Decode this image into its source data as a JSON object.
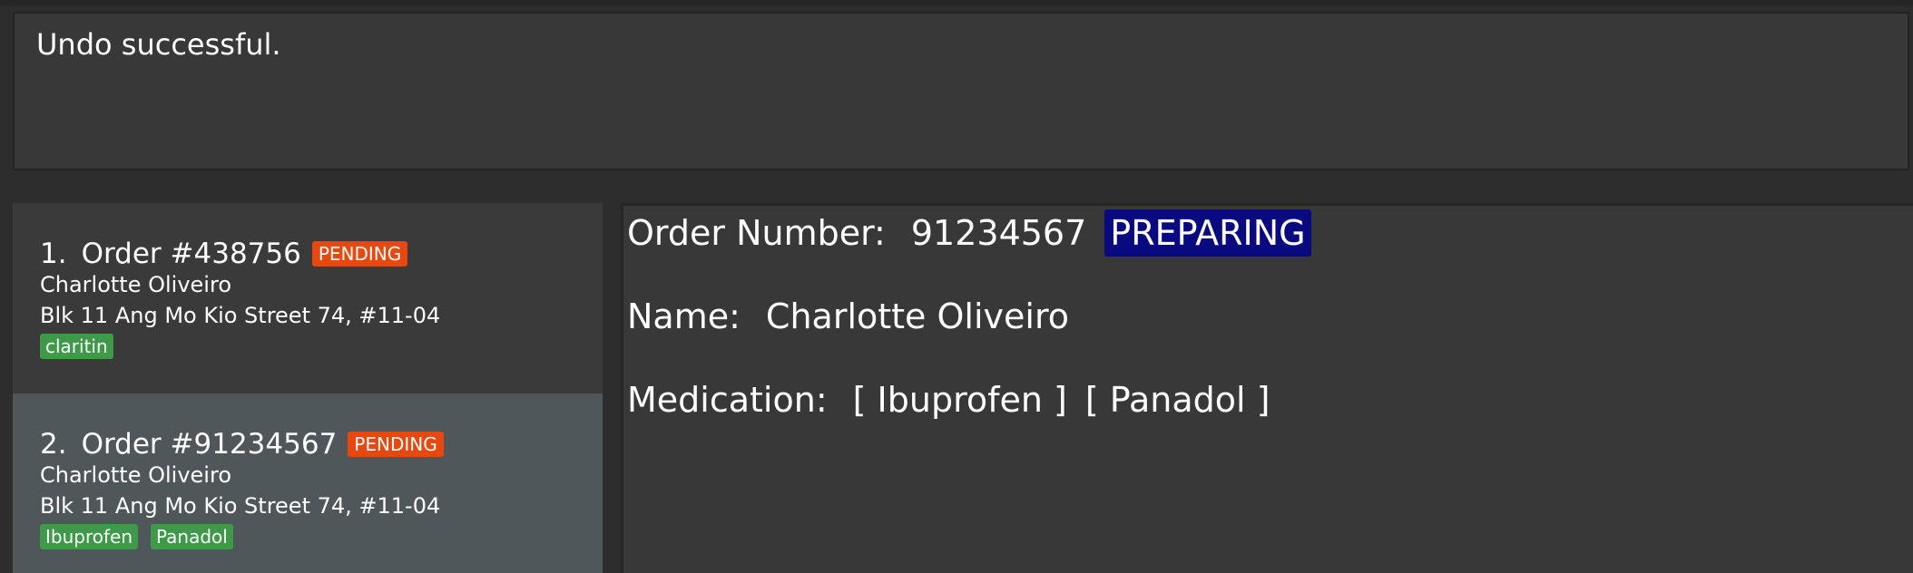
{
  "result_display": {
    "message": "Undo successful."
  },
  "order_list": [
    {
      "index": "1.",
      "title": "Order #438756",
      "status": "PENDING",
      "name": "Charlotte Oliveiro",
      "address": "Blk 11 Ang Mo Kio Street 74, #11-04",
      "medications": [
        "claritin"
      ]
    },
    {
      "index": "2.",
      "title": "Order #91234567",
      "status": "PENDING",
      "name": "Charlotte Oliveiro",
      "address": "Blk 11 Ang Mo Kio Street 74, #11-04",
      "medications": [
        "Ibuprofen",
        "Panadol"
      ]
    }
  ],
  "detail": {
    "order_number_label": "Order Number:",
    "order_number": "91234567",
    "status": "PREPARING",
    "name_label": "Name:",
    "name": "Charlotte Oliveiro",
    "medication_label": "Medication:",
    "medications": [
      "[ Ibuprofen ]",
      "[ Panadol ]"
    ]
  },
  "colors": {
    "pending_tag": "#e8480f",
    "preparing_tag": "#0a0a80",
    "medication_tag": "#3e9a48",
    "selected_card": "#50575a"
  }
}
